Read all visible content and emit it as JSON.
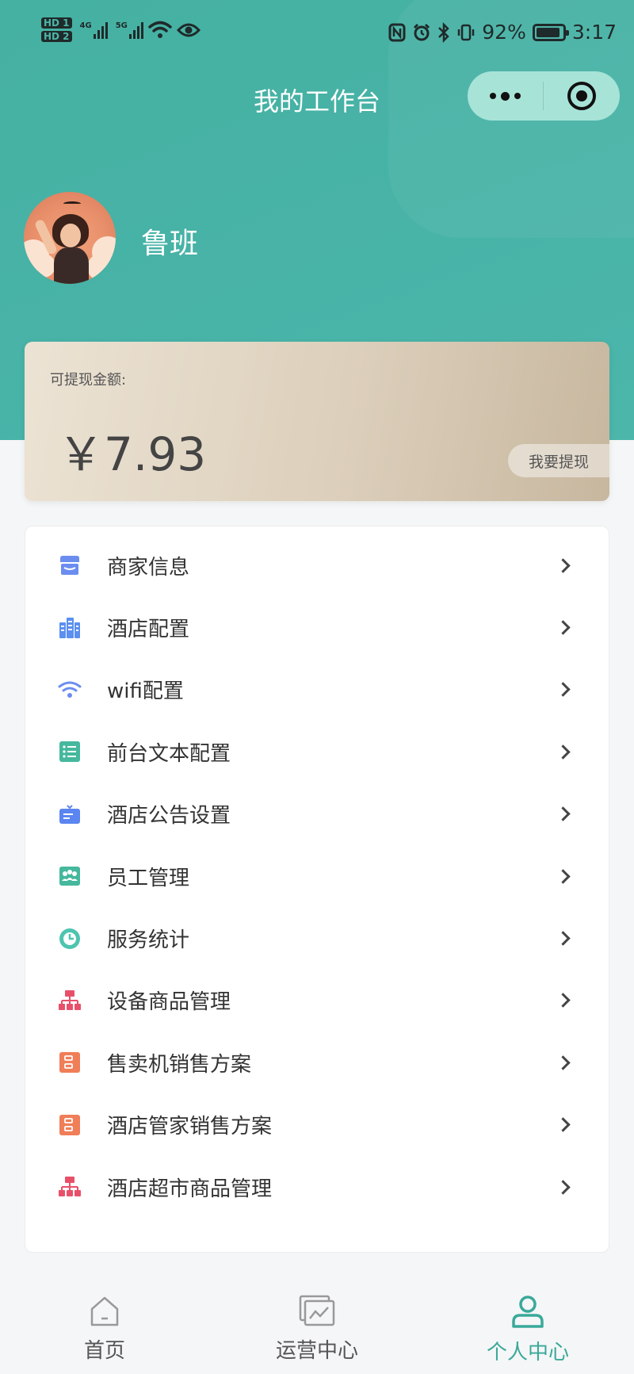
{
  "status_bar": {
    "hd_badges": [
      "HD 1",
      "HD 2"
    ],
    "network_1": "4G",
    "network_2": "5G",
    "battery_percent": "92%",
    "time": "3:17"
  },
  "nav": {
    "title": "我的工作台",
    "capsule_more_icon": "more-dots-icon",
    "capsule_close_icon": "target-close-icon"
  },
  "user": {
    "name": "鲁班"
  },
  "balance": {
    "label": "可提现金额:",
    "amount": "￥7.93",
    "withdraw_label": "我要提现"
  },
  "menu": {
    "items": [
      {
        "label": "商家信息",
        "icon": "store-icon",
        "color": "#6b8df0"
      },
      {
        "label": "酒店配置",
        "icon": "building-icon",
        "color": "#5b8ff0"
      },
      {
        "label": "wifi配置",
        "icon": "wifi-icon",
        "color": "#6b8df0"
      },
      {
        "label": "前台文本配置",
        "icon": "list-icon",
        "color": "#45b89d"
      },
      {
        "label": "酒店公告设置",
        "icon": "notice-icon",
        "color": "#5b85f0"
      },
      {
        "label": "员工管理",
        "icon": "staff-icon",
        "color": "#45b89d"
      },
      {
        "label": "服务统计",
        "icon": "clock-chart-icon",
        "color": "#4ec4b0"
      },
      {
        "label": "设备商品管理",
        "icon": "org-chart-icon",
        "color": "#e8506a"
      },
      {
        "label": "售卖机销售方案",
        "icon": "cabinet-icon",
        "color": "#f07e58"
      },
      {
        "label": "酒店管家销售方案",
        "icon": "cabinet-icon",
        "color": "#f07e58"
      },
      {
        "label": "酒店超市商品管理",
        "icon": "org-chart-icon",
        "color": "#e8506a"
      }
    ]
  },
  "tabbar": {
    "tabs": [
      {
        "label": "首页",
        "icon": "home-icon",
        "active": false
      },
      {
        "label": "运营中心",
        "icon": "chart-window-icon",
        "active": false
      },
      {
        "label": "个人中心",
        "icon": "person-icon",
        "active": true
      }
    ],
    "active_color": "#3aa99a",
    "inactive_color": "#999999"
  },
  "colors": {
    "header": "#48b3a7",
    "capsule": "#a8e3d8"
  }
}
